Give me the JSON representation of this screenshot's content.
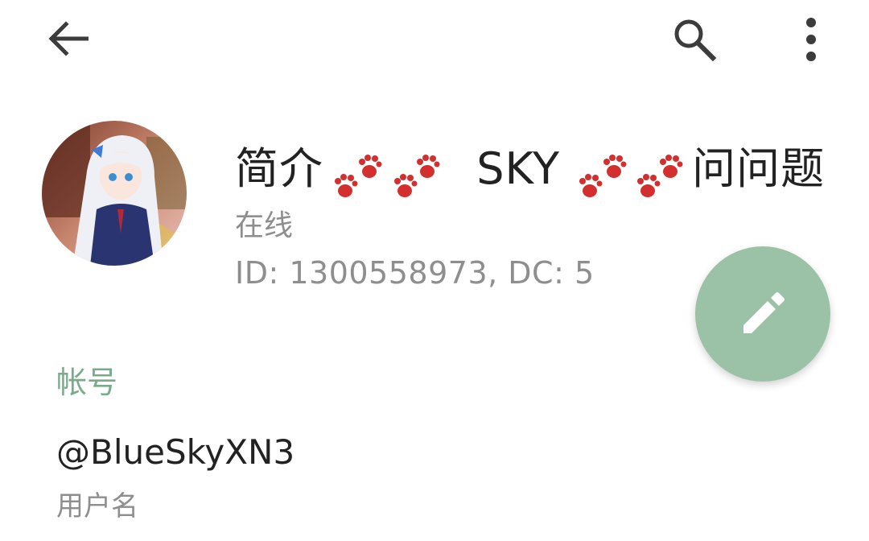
{
  "header": {
    "back_icon": "arrow-left-icon",
    "search_icon": "search-icon",
    "more_icon": "more-vertical-icon"
  },
  "profile": {
    "avatar": "anime-girl-avatar",
    "name_part1": "简介",
    "name_part2": "SKY",
    "name_part3": "问问题",
    "paw_emoji": "🐾",
    "status": "在线",
    "ids": "ID: 1300558973, DC: 5"
  },
  "fab": {
    "icon": "pencil-icon",
    "color": "#9bc2a6"
  },
  "account": {
    "section_title": "帐号",
    "username": "@BlueSkyXN3",
    "username_label": "用户名"
  },
  "colors": {
    "accent": "#79ab8a",
    "text_primary": "#222222",
    "text_secondary": "#8e8e8e",
    "paw": "#d32f2f"
  }
}
